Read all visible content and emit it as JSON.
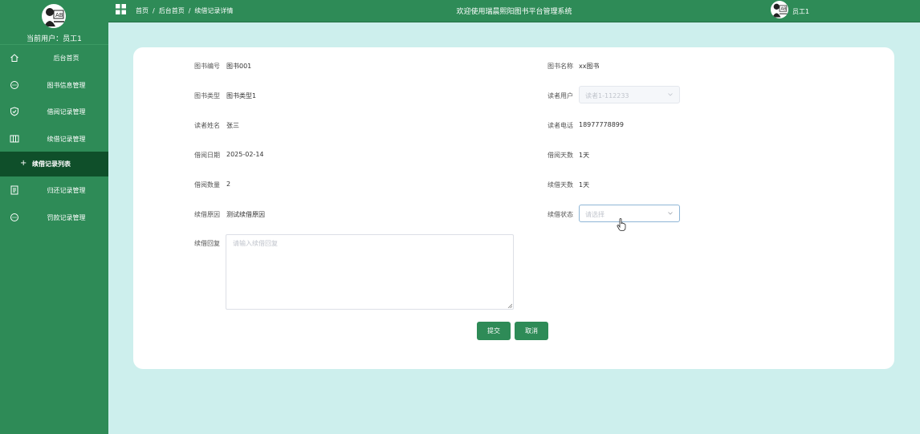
{
  "sidebar": {
    "current_user_label": "当前用户：",
    "current_user_name": "员工1",
    "items": [
      {
        "label": "后台首页",
        "icon": "home-icon"
      },
      {
        "label": "图书信息管理",
        "icon": "chat-bubble-icon"
      },
      {
        "label": "借阅记录管理",
        "icon": "shield-check-icon"
      },
      {
        "label": "续借记录管理",
        "icon": "columns-icon"
      },
      {
        "label": "续借记录列表",
        "icon": "plus-icon"
      },
      {
        "label": "归还记录管理",
        "icon": "document-icon"
      },
      {
        "label": "罚款记录管理",
        "icon": "chat-bubble-icon"
      }
    ]
  },
  "header": {
    "breadcrumb": [
      "首页",
      "后台首页",
      "续借记录详情"
    ],
    "breadcrumb_sep": "/",
    "welcome": "欢迎使用瑞晨熙阳图书平台管理系统",
    "user_name": "员工1"
  },
  "form": {
    "book_no": {
      "label": "图书编号",
      "value": "图书001"
    },
    "book_name": {
      "label": "图书名称",
      "value": "xx图书"
    },
    "book_type": {
      "label": "图书类型",
      "value": "图书类型1"
    },
    "reader_user": {
      "label": "读者用户",
      "value": "读者1-112233"
    },
    "reader_name": {
      "label": "读者姓名",
      "value": "张三"
    },
    "reader_phone": {
      "label": "读者电话",
      "value": "18977778899"
    },
    "borrow_date": {
      "label": "借阅日期",
      "value": "2025-02-14"
    },
    "borrow_days": {
      "label": "借阅天数",
      "value": "1天"
    },
    "borrow_qty": {
      "label": "借阅数量",
      "value": "2"
    },
    "renew_days": {
      "label": "续借天数",
      "value": "1天"
    },
    "renew_reason": {
      "label": "续借原因",
      "value": "测试续借原因"
    },
    "renew_status": {
      "label": "续借状态",
      "placeholder": "请选择"
    },
    "renew_reply": {
      "label": "续借回复",
      "placeholder": "请输入续借回复"
    }
  },
  "buttons": {
    "submit": "提交",
    "cancel": "取消"
  },
  "colors": {
    "primary": "#2e8b57",
    "submenu_active": "#0f4f2a",
    "background": "#cdefed"
  }
}
